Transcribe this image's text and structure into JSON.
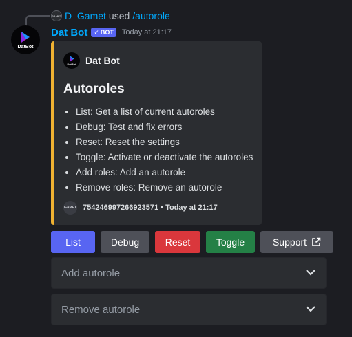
{
  "reply": {
    "avatar_text": "GAMET",
    "username": "D_Gamet",
    "used_text": "used",
    "command": "/autorole"
  },
  "message": {
    "bot_name": "Dat Bot",
    "avatar_text": "DatBot",
    "badge": "BOT",
    "timestamp": "Today at 21:17"
  },
  "embed": {
    "accent_color": "#f0b232",
    "author_name": "Dat Bot",
    "author_avatar_text": "DatBot",
    "title": "Autoroles",
    "items": [
      "List: Get a list of current autoroles",
      "Debug: Test and fix errors",
      "Reset: Reset the settings",
      "Toggle: Activate or deactivate the autoroles",
      "Add roles: Add an autorole",
      "Remove roles: Remove an autorole"
    ],
    "footer_avatar_text": "GAMET",
    "footer_text": "754246997266923571 • Today at 21:17"
  },
  "buttons": {
    "list": "List",
    "debug": "Debug",
    "reset": "Reset",
    "toggle": "Toggle",
    "support": "Support"
  },
  "selects": {
    "add_placeholder": "Add autorole",
    "remove_placeholder": "Remove autorole"
  },
  "icons": {
    "reply_avatar": "user-avatar-icon",
    "bot_avatar": "datbot-logo-icon",
    "verified": "check-icon",
    "external_link": "external-link-icon",
    "dropdown": "chevron-down-icon"
  }
}
